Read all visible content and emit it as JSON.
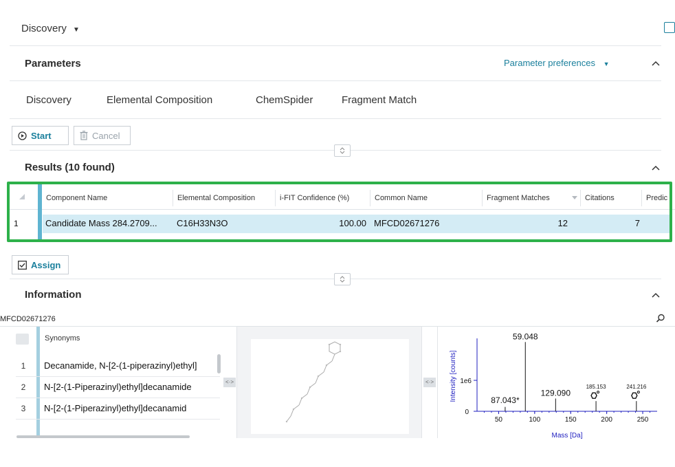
{
  "header": {
    "title": "Discovery"
  },
  "parameters": {
    "title": "Parameters",
    "preferences_label": "Parameter preferences",
    "tabs": [
      {
        "label": "Discovery"
      },
      {
        "label": "Elemental Composition"
      },
      {
        "label": "ChemSpider"
      },
      {
        "label": "Fragment Match"
      }
    ]
  },
  "toolbar": {
    "start_label": "Start",
    "cancel_label": "Cancel"
  },
  "results": {
    "title": "Results (10 found)",
    "columns": [
      "Component Name",
      "Elemental Composition",
      "i-FIT Confidence (%)",
      "Common Name",
      "Fragment Matches",
      "Citations",
      "Predic"
    ],
    "rows": [
      {
        "num": "1",
        "component_name": "Candidate Mass 284.2709...",
        "elemental_composition": "C16H33N3O",
        "confidence": "100.00",
        "common_name": "MFCD02671276",
        "fragment_matches": "12",
        "citations": "7"
      }
    ]
  },
  "assign": {
    "label": "Assign"
  },
  "information": {
    "title": "Information",
    "id_label": "MFCD02671276",
    "synonyms_header": "Synonyms",
    "synonyms": [
      {
        "num": "1",
        "text": "Decanamide, N-[2-(1-piperazinyl)ethyl]"
      },
      {
        "num": "2",
        "text": "N-[2-(1-Piperazinyl)ethyl]decanamide"
      },
      {
        "num": "3",
        "text": "N-[2-(1-Piperazinyl)ethyl]decanamid"
      }
    ]
  },
  "spectrum": {
    "ylabel": "Intensity [counts]",
    "xlabel": "Mass [Da]",
    "y_tick_labels": [
      "0",
      "1e6"
    ],
    "x_tick_labels": [
      "50",
      "100",
      "150",
      "200",
      "250"
    ],
    "peak_labels": [
      "87.043*",
      "59.048",
      "129.090",
      "185.153",
      "241.216"
    ]
  },
  "chart_data": {
    "type": "bar",
    "title": "",
    "xlabel": "Mass [Da]",
    "ylabel": "Intensity [counts]",
    "xlim": [
      20,
      270
    ],
    "ylim": [
      0,
      2000000
    ],
    "x": [
      59.048,
      87.043,
      129.09,
      185.153,
      241.216
    ],
    "values": [
      120000,
      1900000,
      350000,
      280000,
      280000
    ],
    "labels": [
      "59.048",
      "87.043*",
      "129.090",
      "185.153",
      "241.216"
    ]
  },
  "colors": {
    "accent": "#1a7f9c",
    "highlight": "#2db14a",
    "selected_row": "#d4ecf5",
    "row_bar": "#5fb4d1"
  }
}
